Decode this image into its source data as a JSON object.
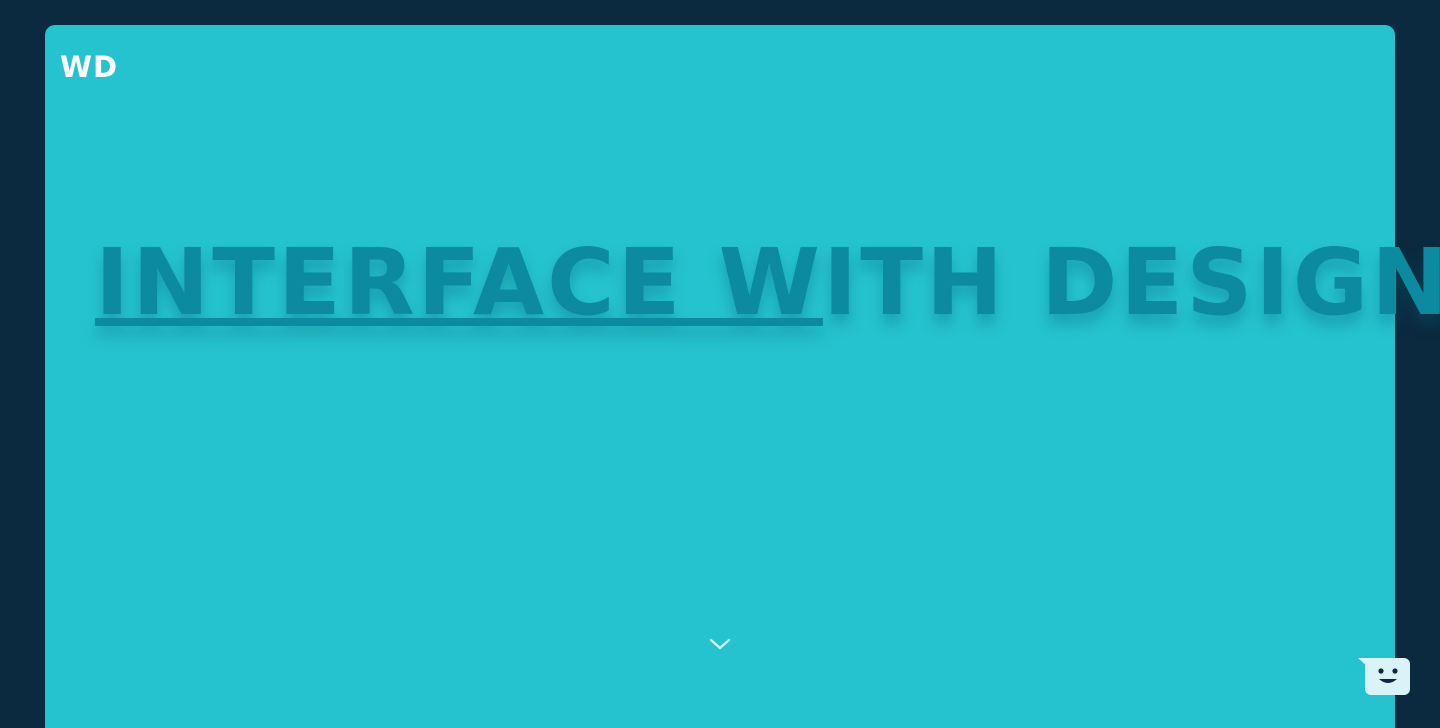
{
  "header": {
    "logo_text": "WD"
  },
  "hero": {
    "headline_part1": "INTERFACE W",
    "headline_part2": "ITH DESIGN."
  },
  "colors": {
    "page_background": "#0b2a3f",
    "hero_background": "#25c3cf",
    "headline_color": "#0b8aa0",
    "logo_color": "#ffffff",
    "chat_widget_color": "#d9f3f7"
  },
  "icons": {
    "scroll_down": "chevron-down-icon",
    "chat": "chat-bot-icon"
  }
}
